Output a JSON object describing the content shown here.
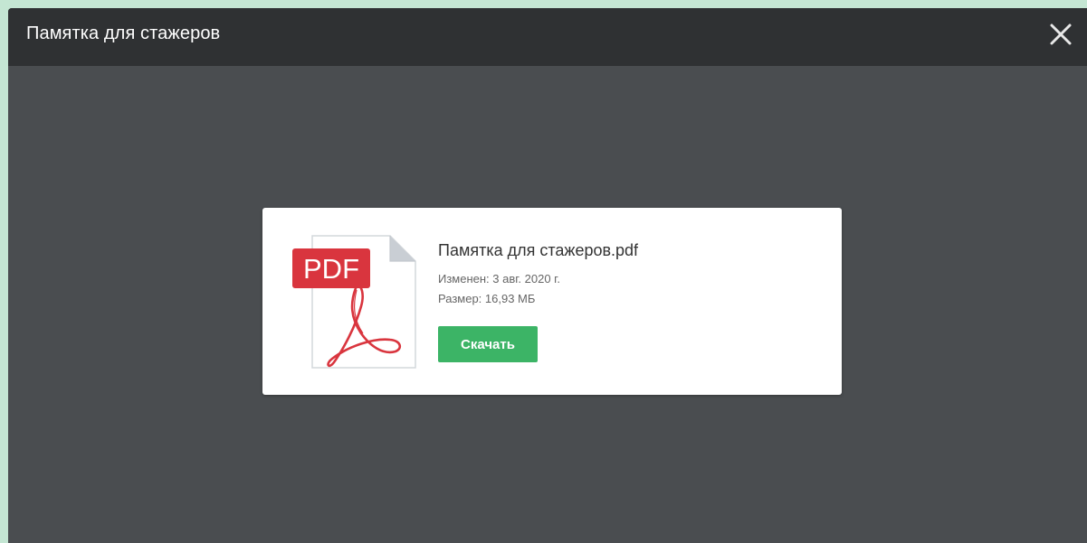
{
  "dialog": {
    "title": "Памятка для стажеров"
  },
  "file": {
    "name": "Памятка для стажеров.pdf",
    "modified": "Изменен: 3 авг. 2020 г.",
    "size": "Размер: 16,93 МБ",
    "type_badge": "PDF",
    "icon": "pdf-file-icon"
  },
  "actions": {
    "download_label": "Скачать",
    "close_icon": "close-icon"
  },
  "colors": {
    "header": "#2f3133",
    "body": "#4a4d50",
    "badge": "#d9353e",
    "acrobat": "#d9353e",
    "download": "#3cb466"
  }
}
